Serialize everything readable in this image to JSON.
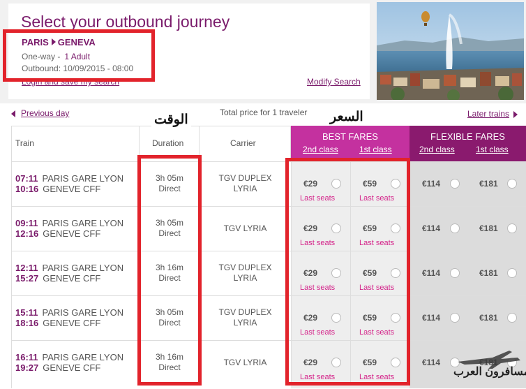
{
  "header": {
    "title": "Select your outbound journey",
    "origin": "PARIS",
    "destination": "GENEVA",
    "trip_type": "One-way -",
    "passengers": "1 Adult",
    "outbound_label": "Outbound:",
    "outbound_datetime": "10/09/2015 - 08:00",
    "login_link": "Login and save my search",
    "modify_link": "Modify Search"
  },
  "nav": {
    "previous": "Previous day",
    "total_price": "Total price for 1 traveler",
    "later": "Later trains"
  },
  "annotations": {
    "time_label": "الوقت",
    "price_label": "السعر",
    "watermark": "المسافرون العرب"
  },
  "table": {
    "col_train": "Train",
    "col_duration": "Duration",
    "col_carrier": "Carrier",
    "best_fares": "BEST FARES",
    "flexible_fares": "FLEXIBLE FARES",
    "second_class": "2nd class",
    "first_class": "1st class",
    "last_seats": "Last seats",
    "rows": [
      {
        "dep": "07:11",
        "arr": "10:16",
        "from": "PARIS GARE LYON",
        "to": "GENEVE CFF",
        "duration": "3h 05m",
        "type": "Direct",
        "carrier1": "TGV DUPLEX",
        "carrier2": "LYRIA",
        "best2": "€29",
        "best1": "€59",
        "flex2": "€114",
        "flex1": "€181"
      },
      {
        "dep": "09:11",
        "arr": "12:16",
        "from": "PARIS GARE LYON",
        "to": "GENEVE CFF",
        "duration": "3h 05m",
        "type": "Direct",
        "carrier1": "TGV LYRIA",
        "carrier2": "",
        "best2": "€29",
        "best1": "€59",
        "flex2": "€114",
        "flex1": "€181"
      },
      {
        "dep": "12:11",
        "arr": "15:27",
        "from": "PARIS GARE LYON",
        "to": "GENEVE CFF",
        "duration": "3h 16m",
        "type": "Direct",
        "carrier1": "TGV DUPLEX",
        "carrier2": "LYRIA",
        "best2": "€29",
        "best1": "€59",
        "flex2": "€114",
        "flex1": "€181"
      },
      {
        "dep": "15:11",
        "arr": "18:16",
        "from": "PARIS GARE LYON",
        "to": "GENEVE CFF",
        "duration": "3h 05m",
        "type": "Direct",
        "carrier1": "TGV DUPLEX",
        "carrier2": "LYRIA",
        "best2": "€29",
        "best1": "€59",
        "flex2": "€114",
        "flex1": "€181"
      },
      {
        "dep": "16:11",
        "arr": "19:27",
        "from": "PARIS GARE LYON",
        "to": "GENEVE CFF",
        "duration": "3h 16m",
        "type": "Direct",
        "carrier1": "TGV LYRIA",
        "carrier2": "",
        "best2": "€29",
        "best1": "€59",
        "flex2": "€114",
        "flex1": "€181"
      }
    ]
  },
  "colors": {
    "brand": "#7a1b6b",
    "best_header": "#c4319f",
    "flex_header": "#8a1a6e",
    "best_bg": "#eeeeee",
    "flex_bg": "#dcdcdc",
    "annotation_red": "#e2232b",
    "last_seats": "#d4248a"
  }
}
